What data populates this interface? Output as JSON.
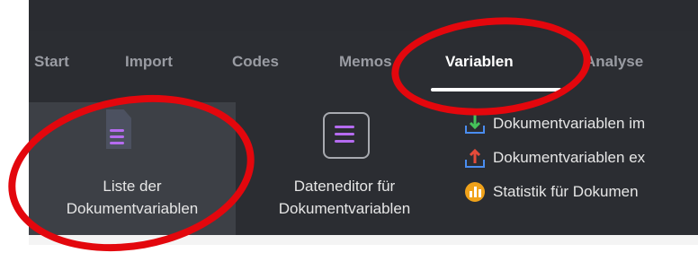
{
  "tabs": [
    {
      "label": "Start"
    },
    {
      "label": "Import"
    },
    {
      "label": "Codes"
    },
    {
      "label": "Memos"
    },
    {
      "label": "Variablen",
      "active": true
    },
    {
      "label": "Analyse"
    }
  ],
  "ribbon": {
    "document_variables_list": {
      "line1": "Liste der",
      "line2": "Dokumentvariablen",
      "icon": "list-icon",
      "selected": true
    },
    "data_editor": {
      "line1": "Dateneditor für",
      "line2": "Dokumentvariablen",
      "icon": "list-icon"
    },
    "small_items": [
      {
        "label": "Dokumentvariablen im",
        "icon": "import-arrow-icon"
      },
      {
        "label": "Dokumentvariablen ex",
        "icon": "export-arrow-icon"
      },
      {
        "label": "Statistik für Dokumen",
        "icon": "statistics-icon"
      }
    ]
  },
  "colors": {
    "toolbar_bg": "#2b2d32",
    "annotation_red": "#e3070d",
    "icon_purple": "#b56bf0"
  }
}
